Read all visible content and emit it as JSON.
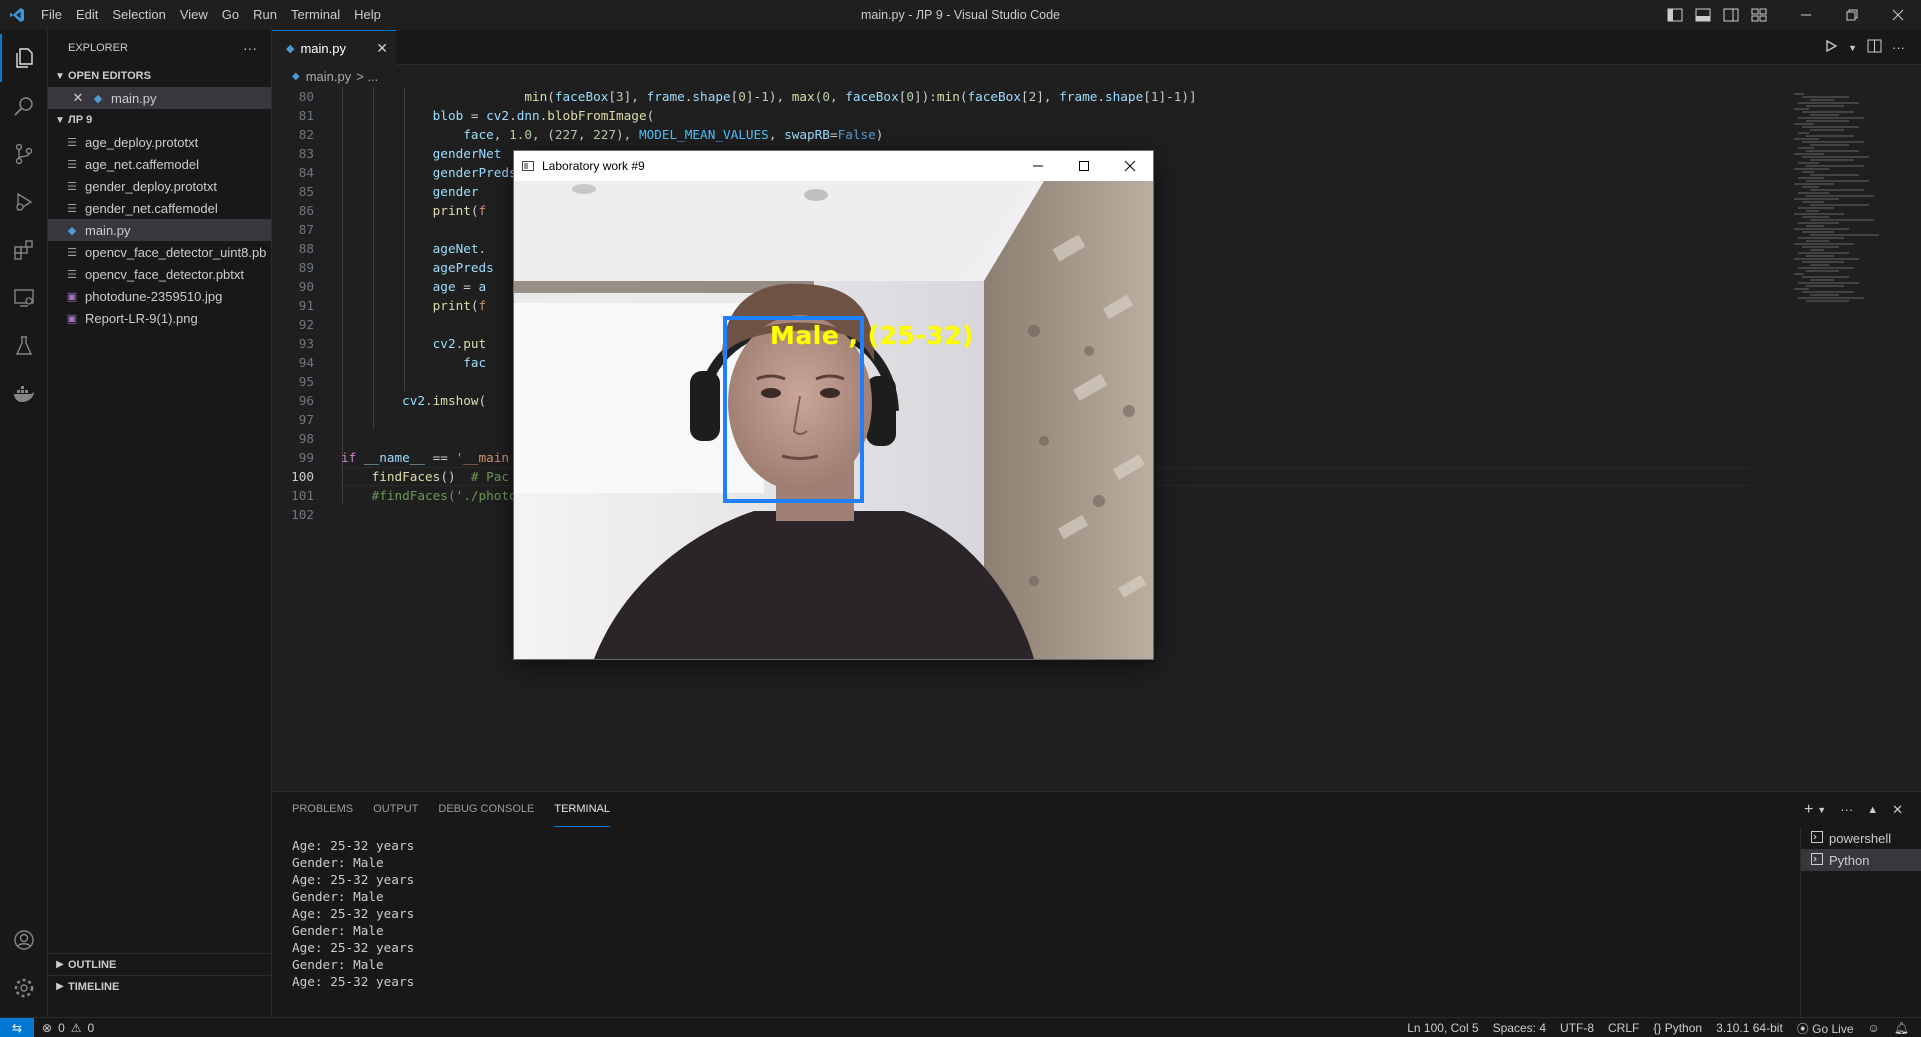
{
  "titlebar": {
    "menu": [
      "File",
      "Edit",
      "Selection",
      "View",
      "Go",
      "Run",
      "Terminal",
      "Help"
    ],
    "window_title": "main.py - ЛР 9 - Visual Studio Code"
  },
  "sidebar": {
    "title": "EXPLORER",
    "more": "···",
    "open_editors_label": "OPEN EDITORS",
    "open_editors": [
      {
        "name": "main.py"
      }
    ],
    "folder_label": "ЛР 9",
    "files": [
      {
        "name": "age_deploy.prototxt",
        "icon": "text-lines-icon"
      },
      {
        "name": "age_net.caffemodel",
        "icon": "text-lines-icon"
      },
      {
        "name": "gender_deploy.prototxt",
        "icon": "text-lines-icon"
      },
      {
        "name": "gender_net.caffemodel",
        "icon": "text-lines-icon"
      },
      {
        "name": "main.py",
        "icon": "python-icon"
      },
      {
        "name": "opencv_face_detector_uint8.pb",
        "icon": "text-lines-icon"
      },
      {
        "name": "opencv_face_detector.pbtxt",
        "icon": "text-lines-icon"
      },
      {
        "name": "photodune-2359510.jpg",
        "icon": "image-icon"
      },
      {
        "name": "Report-LR-9(1).png",
        "icon": "image-icon"
      }
    ],
    "outline_label": "OUTLINE",
    "timeline_label": "TIMELINE"
  },
  "editor": {
    "tab_label": "main.py",
    "breadcrumb_file": "main.py",
    "breadcrumb_rest": "> ...",
    "line_numbers": [
      "80",
      "81",
      "82",
      "83",
      "84",
      "85",
      "86",
      "87",
      "88",
      "89",
      "90",
      "91",
      "92",
      "93",
      "94",
      "95",
      "96",
      "97",
      "98",
      "99",
      "100",
      "101",
      "102"
    ],
    "current_line": "100"
  },
  "panel": {
    "tabs": [
      "PROBLEMS",
      "OUTPUT",
      "DEBUG CONSOLE",
      "TERMINAL"
    ],
    "active_tab": "TERMINAL",
    "terminal_output": "Age: 25-32 years\nGender: Male\nAge: 25-32 years\nGender: Male\nAge: 25-32 years\nGender: Male\nAge: 25-32 years\nGender: Male\nAge: 25-32 years",
    "terminals": [
      "powershell",
      "Python"
    ]
  },
  "statusbar": {
    "errors": "0",
    "warnings": "0",
    "position": "Ln 100, Col 5",
    "spaces": "Spaces: 4",
    "encoding": "UTF-8",
    "eol": "CRLF",
    "language": "Python",
    "interpreter": "3.10.1 64-bit",
    "golive": "Go Live"
  },
  "cv_window": {
    "title": "Laboratory work #9",
    "label": "Male , (25-32)"
  },
  "colors": {
    "accent": "#0078d4",
    "face_box": "#1f7fff",
    "face_label": "#ffff00"
  }
}
